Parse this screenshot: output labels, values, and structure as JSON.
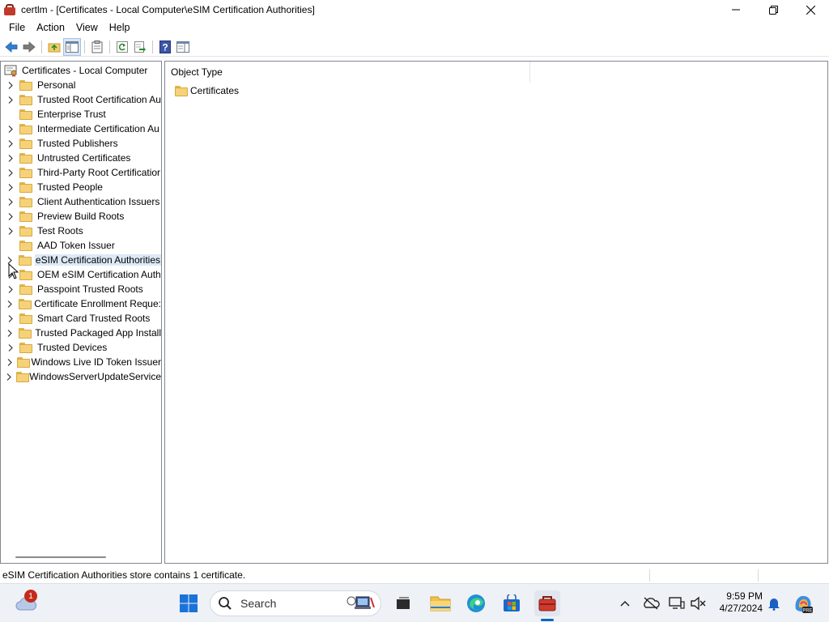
{
  "window": {
    "title": "certlm - [Certificates - Local Computer\\eSIM Certification Authorities]"
  },
  "menu": [
    "File",
    "Action",
    "View",
    "Help"
  ],
  "toolbar": {
    "buttons": [
      "back-icon",
      "forward-icon",
      "up-folder-icon",
      "show-hide-console-tree-icon",
      "properties-icon",
      "refresh-icon",
      "export-list-icon",
      "help-icon",
      "show-action-pane-icon"
    ]
  },
  "tree": {
    "root": "Certificates - Local Computer",
    "items": [
      {
        "label": "Personal",
        "expandable": true
      },
      {
        "label": "Trusted Root Certification Au",
        "expandable": true
      },
      {
        "label": "Enterprise Trust",
        "expandable": false
      },
      {
        "label": "Intermediate Certification Au",
        "expandable": true
      },
      {
        "label": "Trusted Publishers",
        "expandable": true
      },
      {
        "label": "Untrusted Certificates",
        "expandable": true
      },
      {
        "label": "Third-Party Root Certificatior",
        "expandable": true
      },
      {
        "label": "Trusted People",
        "expandable": true
      },
      {
        "label": "Client Authentication Issuers",
        "expandable": true
      },
      {
        "label": "Preview Build Roots",
        "expandable": true
      },
      {
        "label": "Test Roots",
        "expandable": true
      },
      {
        "label": "AAD Token Issuer",
        "expandable": false
      },
      {
        "label": "eSIM Certification Authorities",
        "expandable": true,
        "selected": true
      },
      {
        "label": "OEM eSIM Certification Auth",
        "expandable": true
      },
      {
        "label": "Passpoint Trusted Roots",
        "expandable": true
      },
      {
        "label": "Certificate Enrollment Reque:",
        "expandable": true
      },
      {
        "label": "Smart Card Trusted Roots",
        "expandable": true
      },
      {
        "label": "Trusted Packaged App Install",
        "expandable": true
      },
      {
        "label": "Trusted Devices",
        "expandable": true
      },
      {
        "label": "Windows Live ID Token Issuer",
        "expandable": true
      },
      {
        "label": "WindowsServerUpdateService",
        "expandable": true
      }
    ]
  },
  "list": {
    "column_header": "Object Type",
    "rows": [
      "Certificates"
    ]
  },
  "status": {
    "text": "eSIM Certification Authorities store contains 1 certificate."
  },
  "taskbar": {
    "search_label": "Search",
    "weather_badge": "1",
    "time": "9:59 PM",
    "date": "4/27/2024"
  }
}
